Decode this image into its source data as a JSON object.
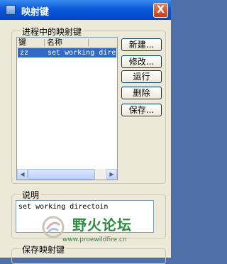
{
  "window": {
    "title": "映射键",
    "close": "X"
  },
  "mapkeys_group": {
    "label": "进程中的映射键",
    "columns": [
      "键",
      "名称"
    ],
    "rows": [
      {
        "key": "zz",
        "name": "set working dire"
      }
    ],
    "scroll_left": "◀",
    "scroll_right": "▶"
  },
  "buttons": {
    "new": "新建...",
    "modify": "修改...",
    "run": "运行",
    "delete": "删除",
    "save": "保存..."
  },
  "description": {
    "label": "说明",
    "text": "set working directoin"
  },
  "save_group": {
    "label": "保存映射键"
  },
  "watermark": {
    "text": "野火论坛",
    "url": "www.proewildfire.cn"
  },
  "colors": {
    "title_bar": "#0a58d8",
    "selection": "#316ac5",
    "dialog_bg": "#ece9d8",
    "watermark": "#2d8a3c"
  }
}
